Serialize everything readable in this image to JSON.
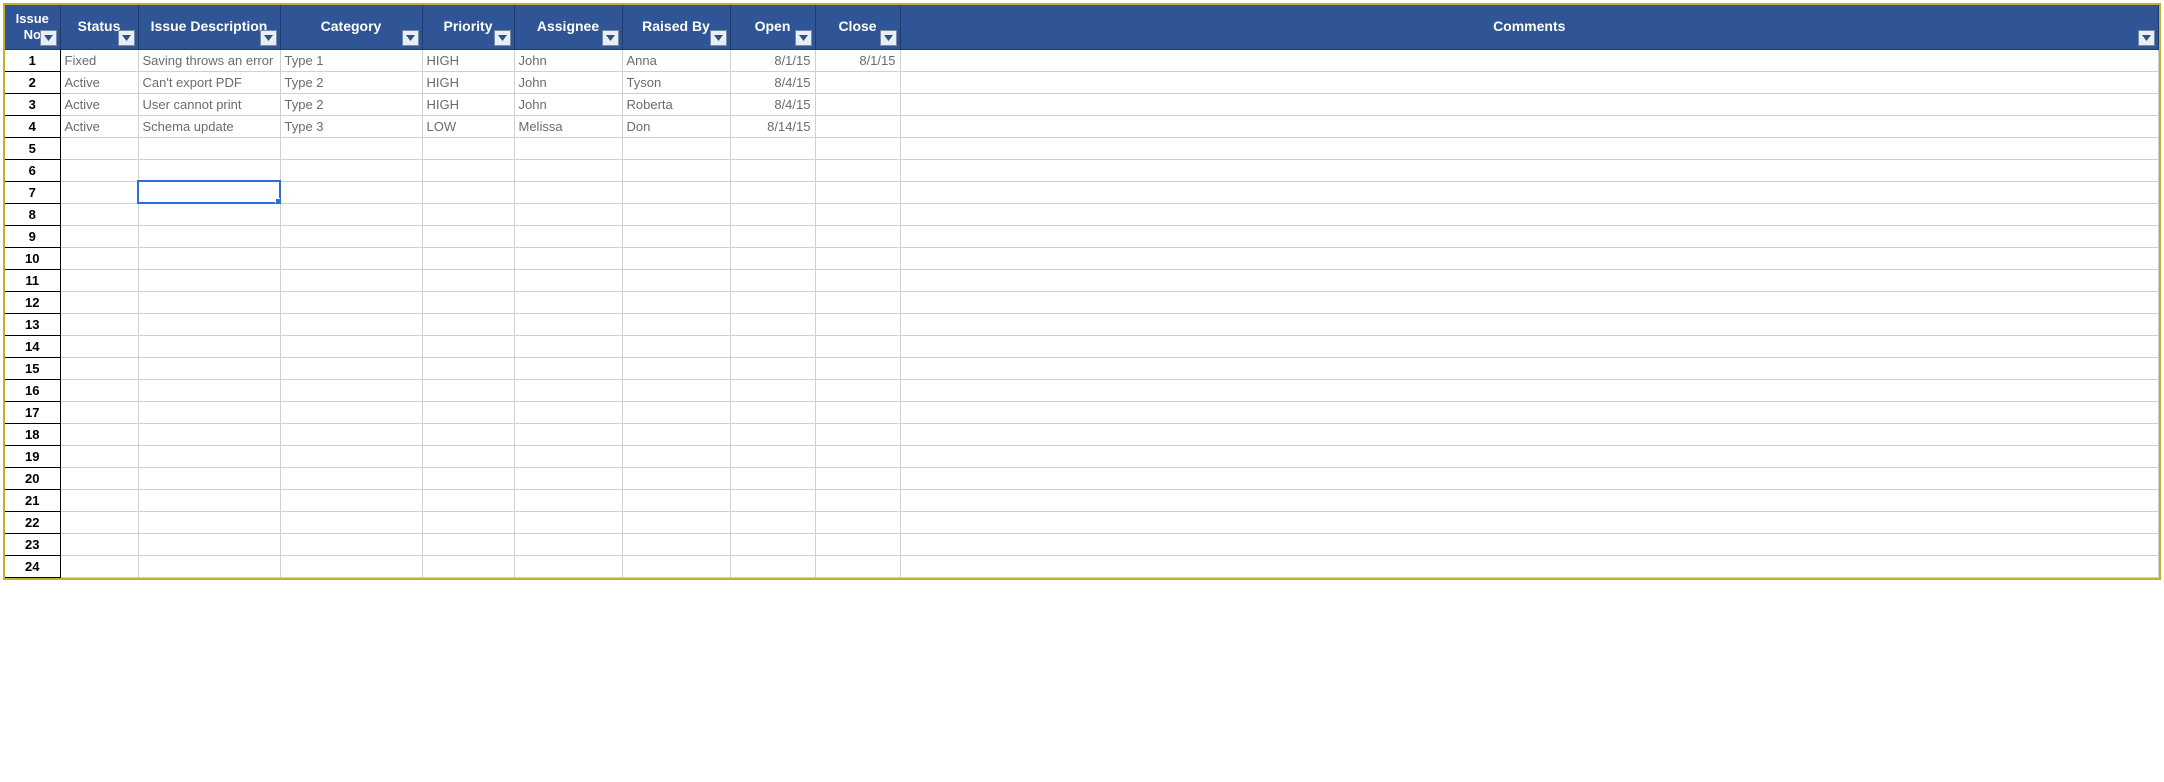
{
  "columns": [
    {
      "key": "issue_no",
      "label": "Issue No",
      "align": "center",
      "numcol": true
    },
    {
      "key": "status",
      "label": "Status",
      "align": "left"
    },
    {
      "key": "description",
      "label": "Issue Description",
      "align": "left"
    },
    {
      "key": "category",
      "label": "Category",
      "align": "left"
    },
    {
      "key": "priority",
      "label": "Priority",
      "align": "left"
    },
    {
      "key": "assignee",
      "label": "Assignee",
      "align": "left"
    },
    {
      "key": "raised_by",
      "label": "Raised By",
      "align": "left"
    },
    {
      "key": "open",
      "label": "Open",
      "align": "right"
    },
    {
      "key": "close",
      "label": "Close",
      "align": "right"
    },
    {
      "key": "comments",
      "label": "Comments",
      "align": "left"
    }
  ],
  "rows": [
    {
      "issue_no": "1",
      "status": "Fixed",
      "description": "Saving throws an error",
      "category": "Type 1",
      "priority": "HIGH",
      "assignee": "John",
      "raised_by": "Anna",
      "open": "8/1/15",
      "close": "8/1/15",
      "comments": ""
    },
    {
      "issue_no": "2",
      "status": "Active",
      "description": "Can't export PDF",
      "category": "Type 2",
      "priority": "HIGH",
      "assignee": "John",
      "raised_by": "Tyson",
      "open": "8/4/15",
      "close": "",
      "comments": ""
    },
    {
      "issue_no": "3",
      "status": "Active",
      "description": "User cannot print",
      "category": "Type 2",
      "priority": "HIGH",
      "assignee": "John",
      "raised_by": "Roberta",
      "open": "8/4/15",
      "close": "",
      "comments": ""
    },
    {
      "issue_no": "4",
      "status": "Active",
      "description": "Schema update",
      "category": "Type 3",
      "priority": "LOW",
      "assignee": "Melissa",
      "raised_by": "Don",
      "open": "8/14/15",
      "close": "",
      "comments": ""
    }
  ],
  "total_visible_rows": 24,
  "selected_cell": {
    "row_index": 6,
    "col_key": "description"
  }
}
